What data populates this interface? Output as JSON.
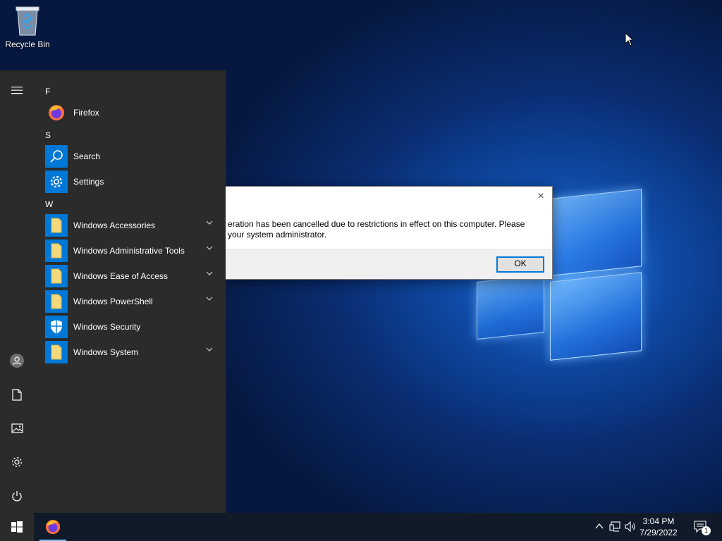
{
  "desktop": {
    "icons": [
      {
        "label": "Recycle Bin"
      }
    ]
  },
  "dialog": {
    "message_line1": "eration has been cancelled due to restrictions in effect on this computer. Please",
    "message_line2": "your system administrator.",
    "ok_label": "OK",
    "close_glyph": "×"
  },
  "start_menu": {
    "groups": [
      {
        "letter": "F",
        "apps": [
          {
            "label": "Firefox",
            "icon": "firefox-icon",
            "expandable": false
          }
        ]
      },
      {
        "letter": "S",
        "apps": [
          {
            "label": "Search",
            "icon": "search-icon",
            "expandable": false
          },
          {
            "label": "Settings",
            "icon": "gear-icon",
            "expandable": false
          }
        ]
      },
      {
        "letter": "W",
        "apps": [
          {
            "label": "Windows Accessories",
            "icon": "folder-icon",
            "expandable": true
          },
          {
            "label": "Windows Administrative Tools",
            "icon": "folder-icon",
            "expandable": true
          },
          {
            "label": "Windows Ease of Access",
            "icon": "folder-icon",
            "expandable": true
          },
          {
            "label": "Windows PowerShell",
            "icon": "folder-icon",
            "expandable": true
          },
          {
            "label": "Windows Security",
            "icon": "shield-icon",
            "expandable": false
          },
          {
            "label": "Windows System",
            "icon": "folder-icon",
            "expandable": true
          }
        ]
      }
    ]
  },
  "taskbar": {
    "time": "3:04 PM",
    "date": "7/29/2022",
    "notification_count": "1"
  },
  "colors": {
    "accent": "#0078d7",
    "start_bg": "#2b2b2b",
    "taskbar_bg": "#101a28",
    "folder_yellow": "#f3d97c"
  }
}
